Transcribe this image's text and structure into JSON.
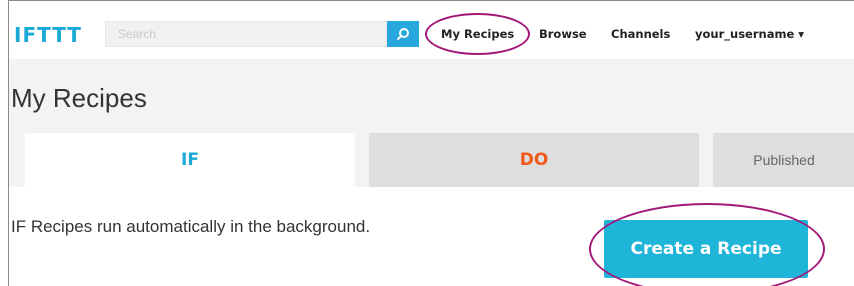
{
  "header": {
    "logo": "IFTTT",
    "search_placeholder": "Search",
    "search_button_icon": "search-icon",
    "nav": {
      "my_recipes": "My Recipes",
      "browse": "Browse",
      "channels": "Channels",
      "user": "your_username ▾"
    }
  },
  "page": {
    "title": "My Recipes"
  },
  "tabs": {
    "if_label": "IF",
    "do_label": "DO",
    "published_label": "Published"
  },
  "content": {
    "description": "IF Recipes run automatically in the background.",
    "create_button": "Create a Recipe"
  },
  "colors": {
    "brand_blue": "#19a9d6",
    "do_orange": "#ef5a1c",
    "highlight_oval": "#a2187a",
    "create_button": "#1eb5d8"
  }
}
